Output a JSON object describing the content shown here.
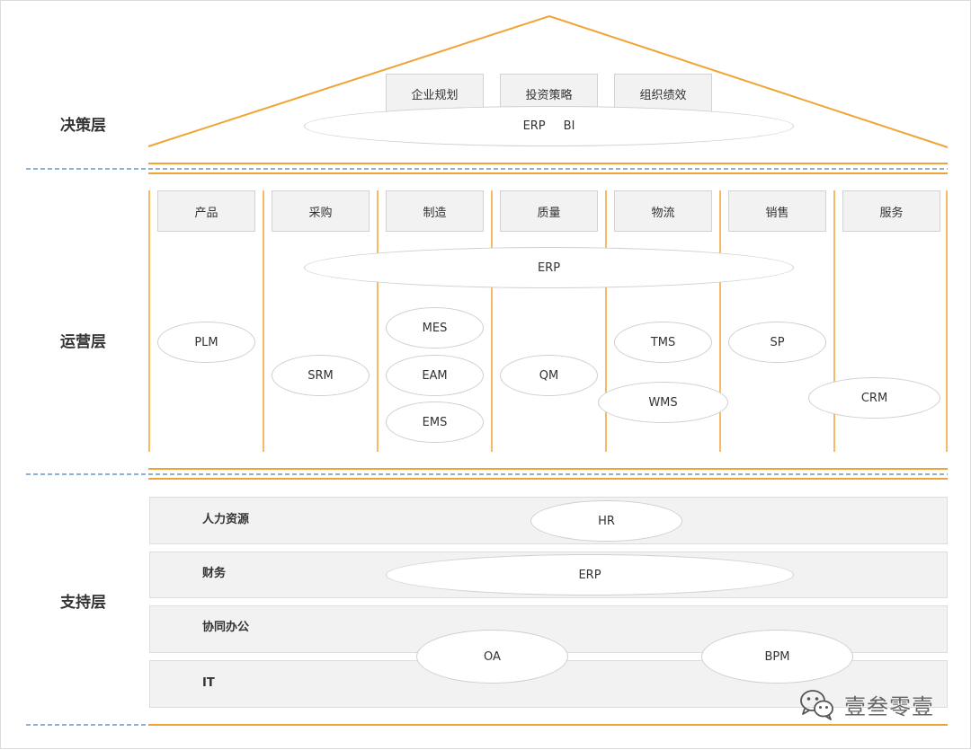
{
  "layers": {
    "decision": "决策层",
    "operations": "运营层",
    "support": "支持层"
  },
  "decision": {
    "boxes": [
      "企业规划",
      "投资策略",
      "组织绩效"
    ],
    "systems": [
      "ERP",
      "BI"
    ]
  },
  "operations": {
    "columns": [
      "产品",
      "采购",
      "制造",
      "质量",
      "物流",
      "销售",
      "服务"
    ],
    "erp": "ERP",
    "systems": {
      "plm": "PLM",
      "srm": "SRM",
      "mes": "MES",
      "eam": "EAM",
      "ems": "EMS",
      "qm": "QM",
      "tms": "TMS",
      "wms": "WMS",
      "sp": "SP",
      "crm": "CRM"
    }
  },
  "support": {
    "rows": [
      "人力资源",
      "财务",
      "协同办公",
      "IT"
    ],
    "systems": {
      "hr": "HR",
      "erp": "ERP",
      "oa": "OA",
      "bpm": "BPM"
    }
  },
  "watermark": "壹叁零壹",
  "colors": {
    "accent_orange": "#f0a436",
    "divider_blue": "#5b9bd5",
    "box_fill": "#f2f2f2"
  },
  "icons": {
    "watermark_icon": "wechat-icon"
  }
}
